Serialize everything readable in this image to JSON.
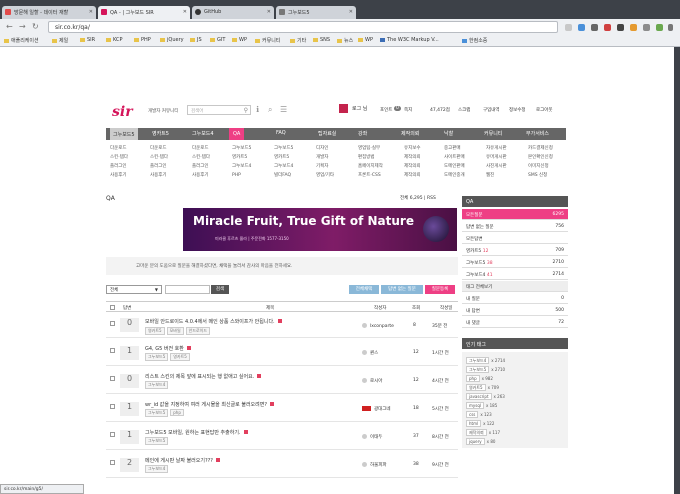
{
  "browser": {
    "tabs": [
      {
        "label": "방문해 일할 - 데이터 재할",
        "active": false
      },
      {
        "label": "QA - | 그누보드 SIR",
        "active": true
      },
      {
        "label": "GitHub",
        "active": false
      },
      {
        "label": "그누보드5",
        "active": false
      }
    ],
    "url": "sir.co.kr/qa/",
    "bookmarks": [
      "애플리케이션",
      "제일",
      "SIR",
      "KCP",
      "PHP",
      "jQuery",
      "JS",
      "GIT",
      "WP",
      "커뮤니티",
      "기타",
      "SNS",
      "뉴스",
      "WP",
      "The W3C Markup V...",
      "한컴소중"
    ],
    "status_url": "sir.co.kr/main/g5/"
  },
  "site": {
    "logo": "sir",
    "top_link": "개발자 커뮤니티",
    "search_placeholder": "검색어",
    "user": "로그 님",
    "points_label": "포인트",
    "points": "47,472점",
    "user_links": [
      "스크랩",
      "쪽지",
      "구입내역",
      "정보수정",
      "로그아웃"
    ],
    "point_badge": "0"
  },
  "nav": {
    "main": [
      "그누보드5",
      "영카트5",
      "그누보드4",
      "QA",
      "FAQ",
      "팁자료실",
      "강좌",
      "제작의뢰",
      "낙찰",
      "커뮤니티",
      "부가서비스"
    ],
    "sub": [
      [
        "다운로드",
        "스킨·템다",
        "플러그인",
        "사용후기"
      ],
      [
        "다운로드",
        "스킨·템다",
        "플러그인",
        "사용후기"
      ],
      [
        "다운로드",
        "스킨·템다",
        "플러그인",
        "사용후기"
      ],
      [
        "그누보드5",
        "영카트5",
        "그누보드4",
        "PHP"
      ],
      [
        "그누보드5",
        "영카트5",
        "그누보드4",
        "빌더FAQ"
      ],
      [
        "디자인",
        "개발자",
        "기획자",
        "영업/기타"
      ],
      [
        "영업팁·실무",
        "편집방법",
        "홈페이지제작",
        "프론트·CSS"
      ],
      [
        "유지보수",
        "제작의뢰",
        "제작의뢰",
        "제작의뢰"
      ],
      [
        "중고판매",
        "사이트판매",
        "도메인판매",
        "도메인중개"
      ],
      [
        "자유게시판",
        "유머게시판",
        "사진게시판",
        "웹진"
      ],
      [
        "카드결제신청",
        "본인확인신청",
        "이미지신청",
        "SMS 신청"
      ]
    ]
  },
  "qa": {
    "title": "QA",
    "count_label": "전체 6,295",
    "rss": "RSS",
    "banner_title": "Miracle Fruit, True Gift of Nature",
    "banner_sub": "미라클 후르츠 올라 | 주문전화 1577-3150",
    "notice": "고마운 분의 도움으로 질문을 해결하셨다면, 채택을 눌러서 감사의 마음을 전하세요.",
    "filter_value": "전체",
    "search_button": "검색",
    "buttons": [
      "전체채택",
      "답변 없는 질문",
      "질문등록"
    ],
    "columns": {
      "answer": "답변",
      "subject": "제목",
      "author": "작성자",
      "views": "조회",
      "date": "작성일"
    },
    "rows": [
      {
        "answers": "0",
        "title": "모바일 안드로이드 4.0.4에서 메인 상품 스와이프가 안됩니다.",
        "tags": [
          "영카트5",
          "모바일",
          "안드로이드"
        ],
        "author": "lxconparte",
        "views": "8",
        "date": "35분 전"
      },
      {
        "answers": "1",
        "title": "G4, G5 버전 호환",
        "tags": [
          "그누보드5",
          "영카트5"
        ],
        "author": "퀀스",
        "views": "12",
        "date": "1시간 전"
      },
      {
        "answers": "0",
        "title": "리스트 스킨의 제목 앞에 표시되는 행 없애고 싶어요.",
        "tags": [
          "그누보드4"
        ],
        "author": "로시아",
        "views": "12",
        "date": "4시간 전"
      },
      {
        "answers": "1",
        "title": "wr_id 값을 지정하여 여러 게시물을 최신글로 불러오려면?",
        "tags": [
          "그누보드5",
          "php"
        ],
        "author": "광대그네",
        "views": "18",
        "date": "5시간 전"
      },
      {
        "answers": "1",
        "title": "그누보드5 모바일, 원하는 표현답만 추출하기.",
        "tags": [
          "그누보드5"
        ],
        "author": "이태두",
        "views": "37",
        "date": "8시간 전"
      },
      {
        "answers": "2",
        "title": "메인에 게시판 날짜 불러오기???",
        "tags": [
          "그누보드4"
        ],
        "author": "하울피파",
        "views": "38",
        "date": "9시간 전"
      }
    ]
  },
  "sidebar": {
    "qa_title": "QA",
    "stats": [
      {
        "label": "모든질문",
        "value": "6295",
        "active": true
      },
      {
        "label": "답변 없는 질문",
        "value": "756"
      },
      {
        "label": "모든답변",
        "value": ""
      },
      {
        "label": "영카트5",
        "badge": "12",
        "value": "709"
      },
      {
        "label": "그누보드5",
        "badge": "38",
        "value": "2710"
      },
      {
        "label": "그누보드4",
        "badge": "41",
        "value": "2714"
      }
    ],
    "more": "태그 전체보기",
    "mine": [
      {
        "label": "내 질문",
        "value": "0"
      },
      {
        "label": "내 답변",
        "value": "500"
      },
      {
        "label": "내 댓글",
        "value": "72"
      }
    ],
    "hot_title": "인기 태그",
    "tags": [
      {
        "name": "그누보드4",
        "count": "2714"
      },
      {
        "name": "그누보드5",
        "count": "2710"
      },
      {
        "name": "php",
        "count": "982"
      },
      {
        "name": "영카트5",
        "count": "709"
      },
      {
        "name": "javascript",
        "count": "263"
      },
      {
        "name": "mysql",
        "count": "185"
      },
      {
        "name": "css",
        "count": "123"
      },
      {
        "name": "html",
        "count": "122"
      },
      {
        "name": "제작의뢰",
        "count": "117"
      },
      {
        "name": "jquery",
        "count": "80"
      },
      {
        "name": "설치",
        "count": "76"
      }
    ]
  }
}
